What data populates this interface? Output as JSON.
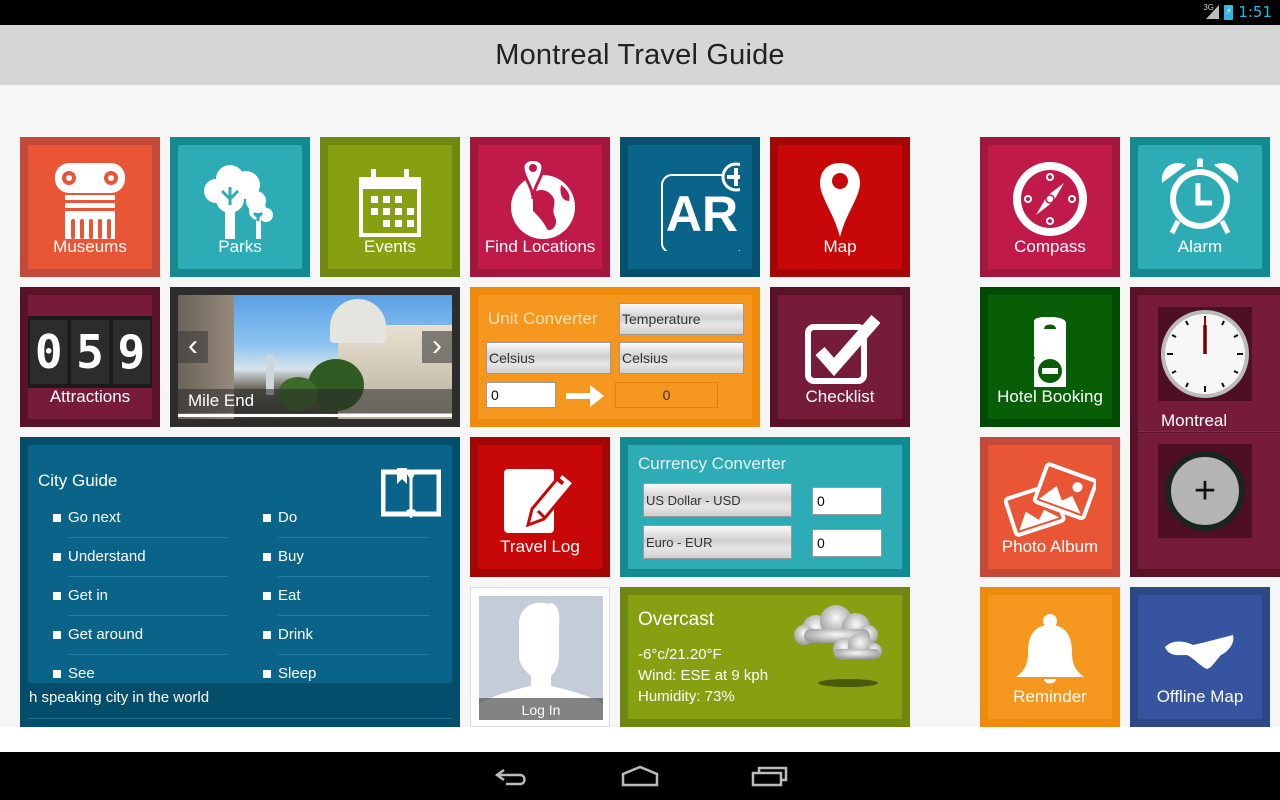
{
  "status_bar": {
    "network": "3G",
    "time": "1:51"
  },
  "header": {
    "title": "Montreal Travel Guide"
  },
  "colors": {
    "orange_red": "#e85636",
    "teal": "#2eacb5",
    "olive": "#86a012",
    "crimson": "#c01a4a",
    "deep_blue": "#0a6389",
    "red": "#c80808",
    "maroon": "#761c3a",
    "orange": "#f5961f",
    "green": "#075e07",
    "royal_blue": "#3754a0"
  },
  "tiles": {
    "museums": {
      "label": "Museums",
      "icon": "column-icon"
    },
    "parks": {
      "label": "Parks",
      "icon": "tree-icon"
    },
    "events": {
      "label": "Events",
      "icon": "calendar-icon"
    },
    "find_locations": {
      "label": "Find Locations",
      "icon": "globe-pin-icon"
    },
    "ar": {
      "label": "AR",
      "icon": "ar-plus-icon"
    },
    "map": {
      "label": "Map",
      "icon": "map-pin-icon"
    },
    "compass": {
      "label": "Compass",
      "icon": "compass-icon"
    },
    "alarm": {
      "label": "Alarm",
      "icon": "alarm-clock-icon"
    },
    "attractions": {
      "label": "Attractions",
      "counter": [
        "0",
        "5",
        "9"
      ]
    },
    "slideshow": {
      "caption": "Mile End",
      "prev": "‹",
      "next": "›"
    },
    "unit_converter": {
      "title": "Unit Converter",
      "category": "Temperature",
      "from_unit": "Celsius",
      "to_unit": "Celsius",
      "input_value": "0",
      "output_value": "0"
    },
    "checklist": {
      "label": "Checklist",
      "icon": "checkbox-icon"
    },
    "hotel_booking": {
      "label": "Hotel Booking",
      "icon": "door-hanger-icon"
    },
    "world_clock": {
      "city": "Montreal",
      "add_label": "+"
    },
    "city_guide": {
      "title": "City Guide",
      "left_items": [
        "Go next",
        "Understand",
        "Get in",
        "Get around",
        "See"
      ],
      "right_items": [
        "Do",
        "Buy",
        "Eat",
        "Drink",
        "Sleep"
      ],
      "ticker": "h speaking city in the world"
    },
    "travel_log": {
      "label": "Travel Log",
      "icon": "edit-note-icon"
    },
    "currency_converter": {
      "title": "Currency Converter",
      "from_currency": "US Dollar - USD",
      "to_currency": "Euro - EUR",
      "from_value": "0",
      "to_value": "0"
    },
    "photo_album": {
      "label": "Photo Album",
      "icon": "photos-icon"
    },
    "login": {
      "label": "Log In"
    },
    "weather": {
      "condition": "Overcast",
      "temperature": "-6°c/21.20°F",
      "wind": "Wind: ESE at 9 kph",
      "humidity": "Humidity: 73%"
    },
    "reminder": {
      "label": "Reminder",
      "icon": "bell-icon"
    },
    "offline_map": {
      "label": "Offline Map",
      "icon": "island-map-icon"
    }
  }
}
